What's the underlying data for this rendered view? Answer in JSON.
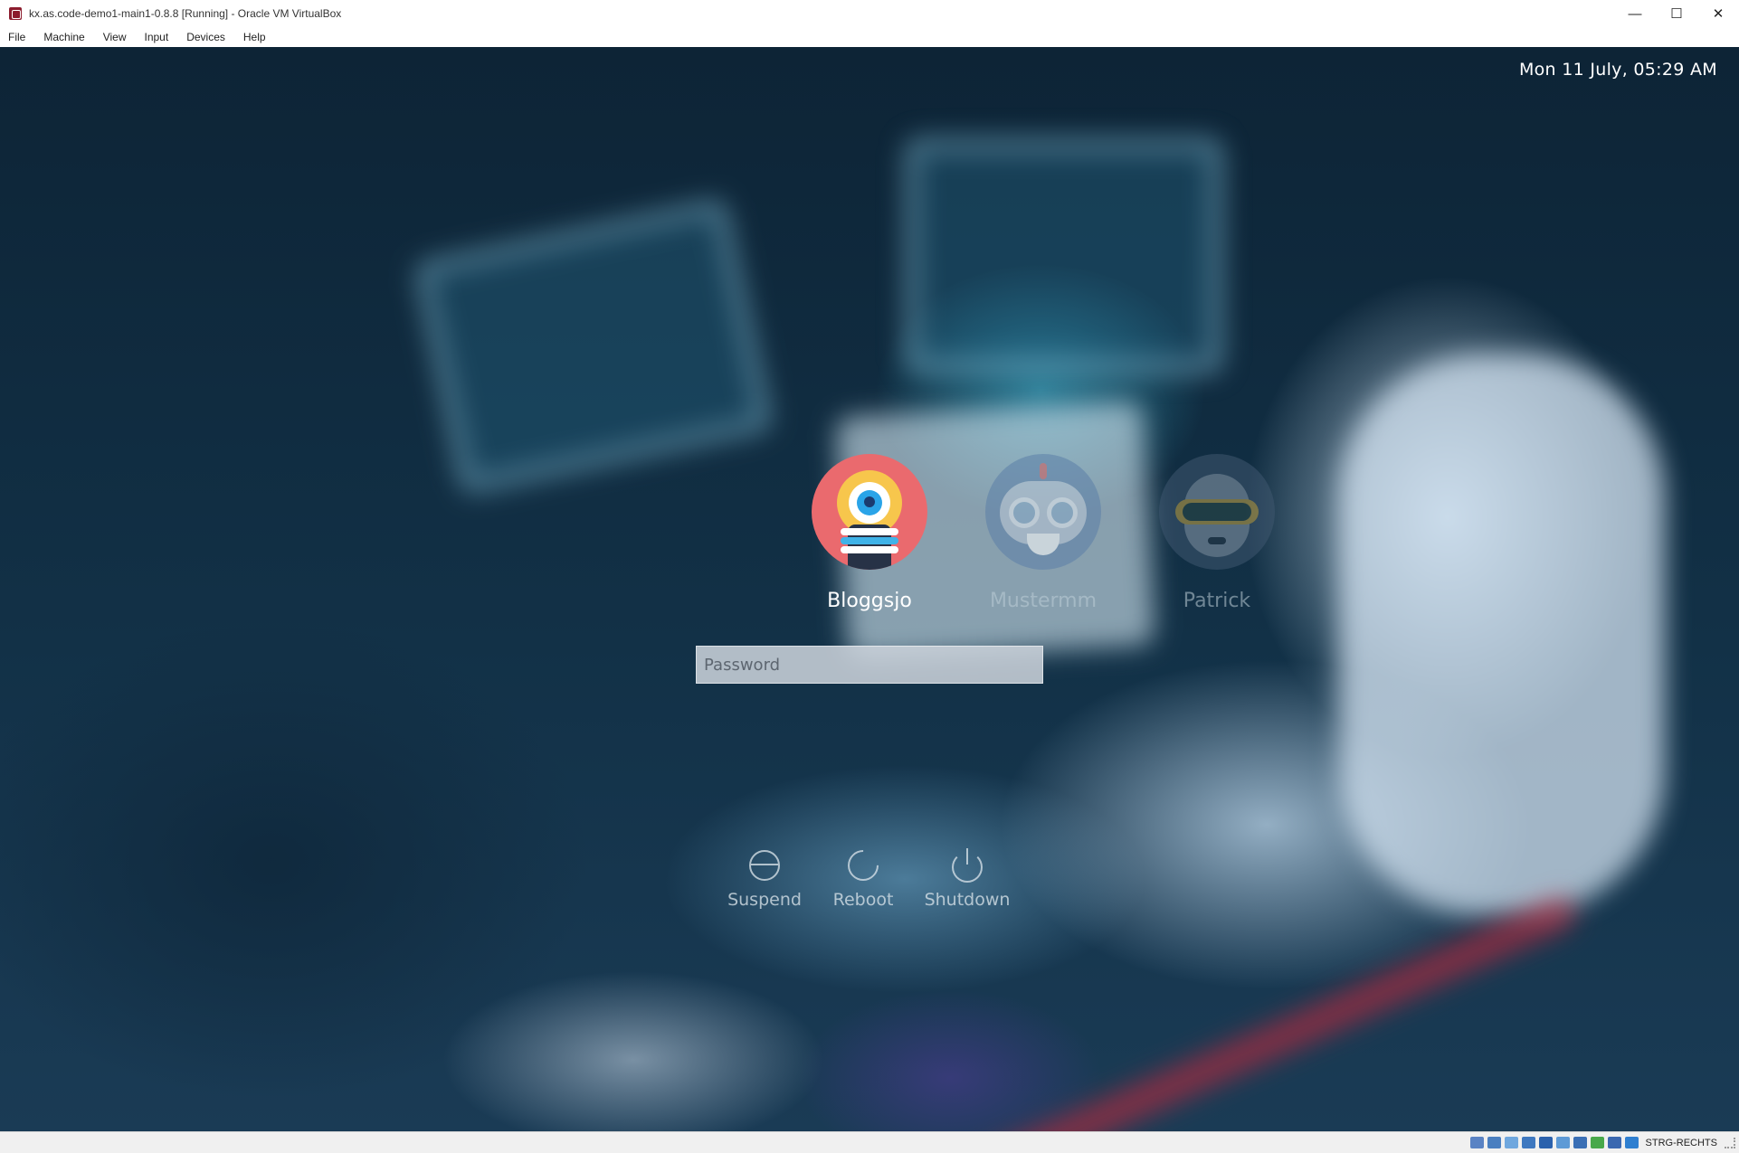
{
  "window": {
    "title": "kx.as.code-demo1-main1-0.8.8 [Running] - Oracle VM VirtualBox",
    "minimize_glyph": "—",
    "maximize_glyph": "☐",
    "close_glyph": "✕"
  },
  "menu": {
    "items": [
      "File",
      "Machine",
      "View",
      "Input",
      "Devices",
      "Help"
    ]
  },
  "login": {
    "datetime": "Mon 11 July,  05:29 AM",
    "users": [
      {
        "name": "Bloggsjo",
        "selected": true,
        "icon": "yellow-one-eyed-robot-avatar"
      },
      {
        "name": "Mustermm",
        "selected": false,
        "icon": "grey-robot-with-goggles-avatar"
      },
      {
        "name": "Patrick",
        "selected": false,
        "icon": "robot-with-vr-visor-avatar"
      }
    ],
    "password_placeholder": "Password",
    "password_value": "",
    "actions": [
      {
        "label": "Suspend",
        "icon": "suspend-icon"
      },
      {
        "label": "Reboot",
        "icon": "reboot-icon"
      },
      {
        "label": "Shutdown",
        "icon": "shutdown-icon"
      }
    ]
  },
  "statusbar": {
    "host_key": "STRG-RECHTS",
    "icons": [
      "hard-disk-icon",
      "optical-drive-icon",
      "audio-icon",
      "network-icon",
      "usb-icon",
      "shared-folder-icon",
      "display-icon",
      "recording-icon",
      "cpu-icon",
      "mouse-integration-icon"
    ]
  },
  "colors": {
    "virtualbox_accent": "#8c1c2e",
    "selected_user_text": "#ffffff",
    "dim_user_text": "#bfcdd7"
  }
}
